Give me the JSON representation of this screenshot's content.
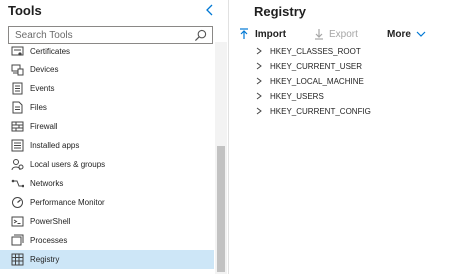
{
  "tools": {
    "title": "Tools",
    "search_placeholder": "Search Tools",
    "items": [
      {
        "label": "Certificates",
        "icon": "certificate-icon"
      },
      {
        "label": "Devices",
        "icon": "devices-icon"
      },
      {
        "label": "Events",
        "icon": "events-icon"
      },
      {
        "label": "Files",
        "icon": "files-icon"
      },
      {
        "label": "Firewall",
        "icon": "firewall-icon"
      },
      {
        "label": "Installed apps",
        "icon": "installed-apps-icon"
      },
      {
        "label": "Local users & groups",
        "icon": "users-icon"
      },
      {
        "label": "Networks",
        "icon": "network-icon"
      },
      {
        "label": "Performance Monitor",
        "icon": "performance-icon"
      },
      {
        "label": "PowerShell",
        "icon": "powershell-icon"
      },
      {
        "label": "Processes",
        "icon": "processes-icon"
      },
      {
        "label": "Registry",
        "icon": "registry-icon",
        "selected": true
      }
    ]
  },
  "registry": {
    "title": "Registry",
    "toolbar": {
      "import_label": "Import",
      "export_label": "Export",
      "more_label": "More"
    },
    "keys": [
      "HKEY_CLASSES_ROOT",
      "HKEY_CURRENT_USER",
      "HKEY_LOCAL_MACHINE",
      "HKEY_USERS",
      "HKEY_CURRENT_CONFIG"
    ]
  },
  "colors": {
    "accent": "#0078d4",
    "selected_bg": "#cde6f7",
    "disabled_text": "#a6a6a6"
  }
}
